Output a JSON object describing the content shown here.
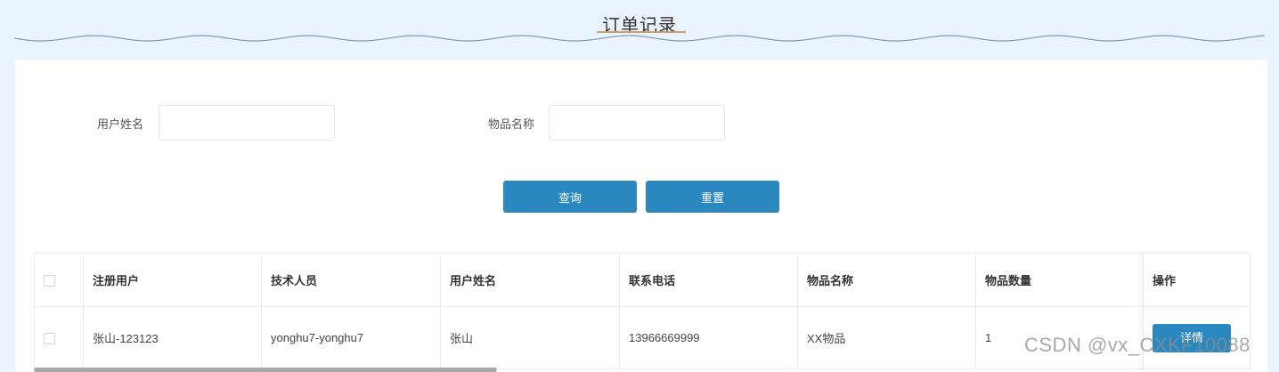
{
  "header": {
    "title": "订单记录"
  },
  "search": {
    "username_label": "用户姓名",
    "username_value": "",
    "itemname_label": "物品名称",
    "itemname_value": "",
    "query_label": "查询",
    "reset_label": "重置"
  },
  "table": {
    "columns": [
      "注册用户",
      "技术人员",
      "用户姓名",
      "联系电话",
      "物品名称",
      "物品数量",
      "操作"
    ],
    "rows": [
      {
        "registered_user": "张山-123123",
        "technician": "yonghu7-yonghu7",
        "user_name": "张山",
        "phone": "13966669999",
        "item_name": "XX物品",
        "quantity": "1",
        "action_label": "详情"
      }
    ]
  },
  "watermark": "CSDN @vx_CXKF10088",
  "colors": {
    "primary": "#2a87c0",
    "background": "#eaf3fd",
    "accent": "#c9a06b"
  }
}
